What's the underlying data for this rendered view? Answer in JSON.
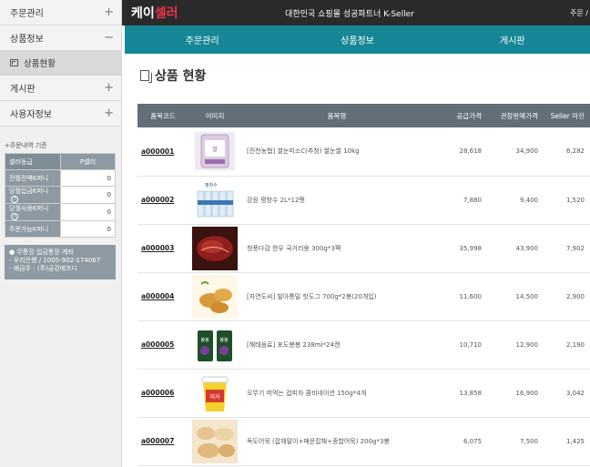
{
  "header": {
    "logo_main": "케이",
    "logo_accent": "셀러",
    "slogan": "대한민국 쇼핑몰 성공파트너 K-Seller",
    "top_right": "주문 /"
  },
  "nav": {
    "tabs": [
      "주문관리",
      "상품정보",
      "게시판"
    ]
  },
  "sidebar": {
    "items": [
      {
        "label": "주문관리",
        "toggle": "+"
      },
      {
        "label": "상품정보",
        "toggle": "−"
      },
      {
        "label": "상품현황",
        "sub": true
      },
      {
        "label": "게시판",
        "toggle": "+"
      },
      {
        "label": "사용자정보",
        "toggle": "+"
      }
    ],
    "order_title": "+주문내역 기준",
    "info_rows": [
      {
        "label": "셀러등급",
        "value": "P셀러"
      },
      {
        "label": "전월전액K머니",
        "value": "0"
      },
      {
        "label": "당월입금K머니",
        "value": "0",
        "help": "?"
      },
      {
        "label": "당월사용K머니",
        "value": "0",
        "help": "?"
      },
      {
        "label": "주문가능K머니",
        "value": "0"
      }
    ],
    "bank": {
      "line1": "● 무통장 입금통장 계좌",
      "line2": "- 우리은행 / 1005-902-174067",
      "line3": "- 예금주 : (주)금강에프디"
    }
  },
  "page_title": "상품 현황",
  "table": {
    "headers": [
      "품목코드",
      "이미지",
      "품목명",
      "공급가격",
      "권장판매가격",
      "Seller 마진"
    ],
    "rows": [
      {
        "code": "a000001",
        "name": "[진천농협] 쌀눈미소C(추청) 쌀눈쌀 10kg",
        "supply": "28,618",
        "retail": "34,900",
        "margin": "6,282",
        "thumb": "rice"
      },
      {
        "code": "a000002",
        "name": "강원 평창수 2L*12펫",
        "supply": "7,880",
        "retail": "9,400",
        "margin": "1,520",
        "thumb": "water"
      },
      {
        "code": "a000003",
        "name": "청풍다감 한우 국거리용 300g*3팩",
        "supply": "35,998",
        "retail": "43,900",
        "margin": "7,902",
        "thumb": "beef"
      },
      {
        "code": "a000004",
        "name": "[자연도씨] 발아통밀 핫도그 700g*2봉(20개입)",
        "supply": "11,600",
        "retail": "14,500",
        "margin": "2,900",
        "thumb": "hotdog"
      },
      {
        "code": "a000005",
        "name": "[해태음료] 포도봉봉 238ml*24캔",
        "supply": "10,710",
        "retail": "12,900",
        "margin": "2,190",
        "thumb": "can"
      },
      {
        "code": "a000006",
        "name": "오뚜기 떠먹는 컵피자 콤비네이션 150g*4개",
        "supply": "13,858",
        "retail": "16,900",
        "margin": "3,042",
        "thumb": "cup"
      },
      {
        "code": "a000007",
        "name": "독도어묵 (잡채말이+매운잡채+종합어묵) 200g*3봉",
        "supply": "6,075",
        "retail": "7,500",
        "margin": "1,425",
        "thumb": "fishcake"
      }
    ]
  }
}
